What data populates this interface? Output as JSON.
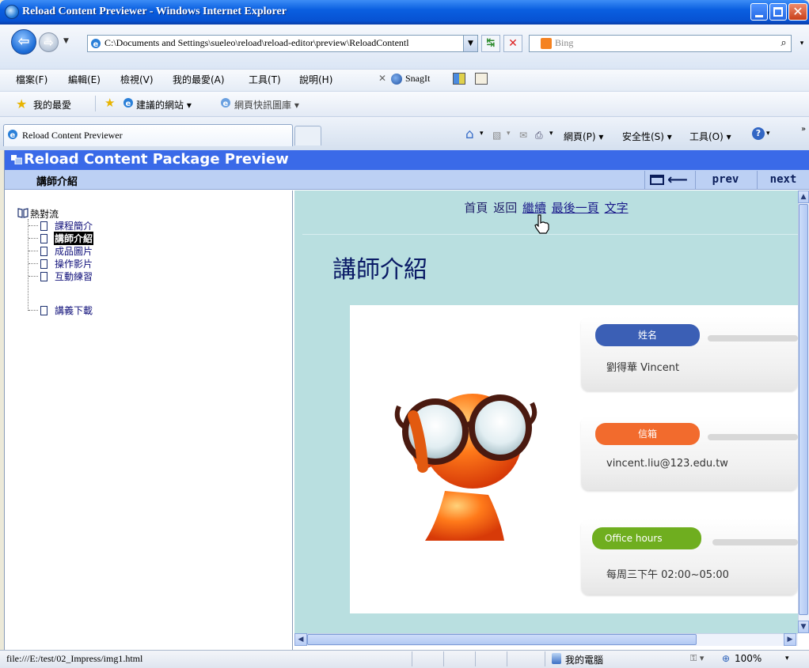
{
  "window": {
    "title": "Reload Content Previewer - Windows Internet Explorer"
  },
  "address": {
    "url": "C:\\Documents and Settings\\sueleo\\reload\\reload-editor\\preview\\ReloadContentl",
    "search_placeholder": "Bing"
  },
  "menu": [
    "檔案(F)",
    "編輯(E)",
    "檢視(V)",
    "我的最愛(A)",
    "工具(T)",
    "說明(H)"
  ],
  "snagit_label": "SnagIt",
  "favorites": {
    "label": "我的最愛",
    "suggested_sites": "建議的網站 ▾",
    "web_slice": "網頁快訊圖庫 ▾"
  },
  "tab": {
    "label": "Reload Content Previewer"
  },
  "commands": {
    "page": "網頁(P) ▾",
    "safety": "安全性(S) ▾",
    "tools": "工具(O) ▾"
  },
  "reload": {
    "banner_title": "Reload Content Package Preview",
    "current_item": "講師介紹",
    "prev_label": "prev",
    "next_label": "next"
  },
  "tree": {
    "root": "熱對流",
    "items": [
      {
        "label": "課程簡介",
        "selected": false
      },
      {
        "label": "講師介紹",
        "selected": true
      },
      {
        "label": "成品圖片",
        "selected": false
      },
      {
        "label": "操作影片",
        "selected": false
      },
      {
        "label": "互動練習",
        "selected": false
      },
      {
        "label": "講義下載",
        "selected": false
      }
    ]
  },
  "page": {
    "nav": {
      "home": "首頁",
      "back": "返回",
      "continue": "繼續",
      "last_page": "最後一頁",
      "text": "文字"
    },
    "heading": "講師介紹",
    "fields": [
      {
        "label": "姓名",
        "value": "劉得華  Vincent",
        "color": "#3b5fb5"
      },
      {
        "label": "信箱",
        "value": "vincent.liu@123.edu.tw",
        "color": "#f26b2d"
      },
      {
        "label": "Office hours",
        "value": "每周三下午 02:00~05:00",
        "color": "#6fae1f"
      }
    ]
  },
  "status": {
    "url": "file:///E:/test/02_Impress/img1.html",
    "zone": "我的電腦",
    "zoom": "100%"
  }
}
